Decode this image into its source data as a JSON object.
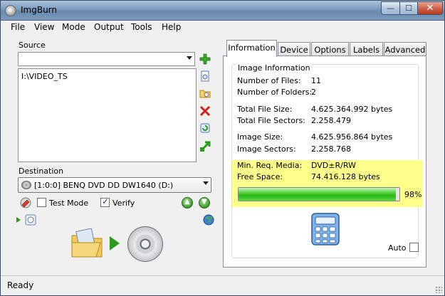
{
  "window": {
    "title": "ImgBurn",
    "controls": {
      "minimize": "—",
      "maximize": "☐",
      "close": "✕"
    }
  },
  "menu": [
    "File",
    "View",
    "Mode",
    "Output",
    "Tools",
    "Help"
  ],
  "source": {
    "label": "Source",
    "combo_value": "",
    "list": [
      "I:\\VIDEO_TS"
    ],
    "icons": [
      "add-icon",
      "browse-file-icon",
      "browse-folder-icon",
      "remove-icon",
      "refresh-icon",
      "move-icon"
    ]
  },
  "destination": {
    "label": "Destination",
    "drive": "[1:0:0] BENQ DVD DD DW1640 (D:)",
    "test_mode_label": "Test Mode",
    "test_mode": false,
    "verify_label": "Verify",
    "verify": true
  },
  "tabs": [
    "Information",
    "Device",
    "Options",
    "Labels",
    "Advanced"
  ],
  "active_tab": "Information",
  "info": {
    "group_title": "Image Information",
    "rows": [
      {
        "label": "Number of Files:",
        "value": "11"
      },
      {
        "label": "Number of Folders:",
        "value": "2"
      },
      {
        "label": "Total File Size:",
        "value": "4.625.364.992 bytes"
      },
      {
        "label": "Total File Sectors:",
        "value": "2.258.479"
      },
      {
        "label": "Image Size:",
        "value": "4.625.956.864 bytes"
      },
      {
        "label": "Image Sectors:",
        "value": "2.258.768"
      },
      {
        "label": "Min. Req. Media:",
        "value": "DVD±R/RW"
      },
      {
        "label": "Free Space:",
        "value": "74.416.128 bytes"
      }
    ],
    "progress_percent": 98,
    "progress_text": "98%",
    "auto_label": "Auto",
    "auto": false,
    "highlight_color": "#ffff8c"
  },
  "status": "Ready"
}
